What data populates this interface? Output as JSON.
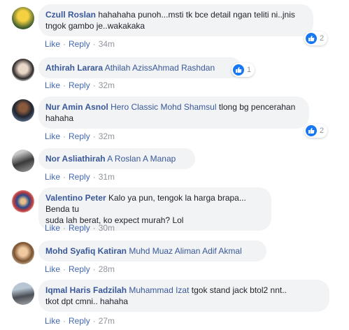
{
  "comments": [
    {
      "name": "Czull Roslan",
      "tags": "",
      "text1": "hahahaha punoh...msti tk bce detail ngan teliti ni..jnis",
      "text2": "tngok gambo je..wakakaka",
      "time": "34m",
      "reactions": "2"
    },
    {
      "name": "Athirah Larara",
      "tags": "Athilah AzissAhmad Rashdan",
      "time": "32m",
      "reactions": "1"
    },
    {
      "name": "Nur Amin Asnol",
      "tags": "Hero Classic Mohd Shamsul",
      "text1": "tlong bg pencerahan",
      "text2": "hahaha",
      "time": "32m",
      "reactions": "2"
    },
    {
      "name": "Nor Asliathirah",
      "tags": "A Roslan A Manap",
      "time": "31m"
    },
    {
      "name": "Valentino Peter",
      "tags": "",
      "text1": "Kalo ya pun, tengok la harga brapa... Benda tu",
      "text2": "suda lah berat, ko expect murah? Lol",
      "time": "30m"
    },
    {
      "name": "Mohd Syafiq Katiran",
      "tags": "Muhd Muaz Aliman Adif Akmal",
      "time": "28m"
    },
    {
      "name": "Iqmal Haris Fadzilah",
      "tags": "Muhammad Izat",
      "text1": "tgok stand jack btol2 nnt..",
      "text2": "tkot dpt cmni.. hahaha",
      "time": "27m"
    }
  ],
  "actions": {
    "like": "Like",
    "reply": "Reply",
    "separator": "·"
  },
  "colors": {
    "name": "#385898",
    "link": "#4267b2",
    "bubble": "#f2f3f5",
    "meta": "#90949c",
    "like_icon": "#1877f2"
  }
}
